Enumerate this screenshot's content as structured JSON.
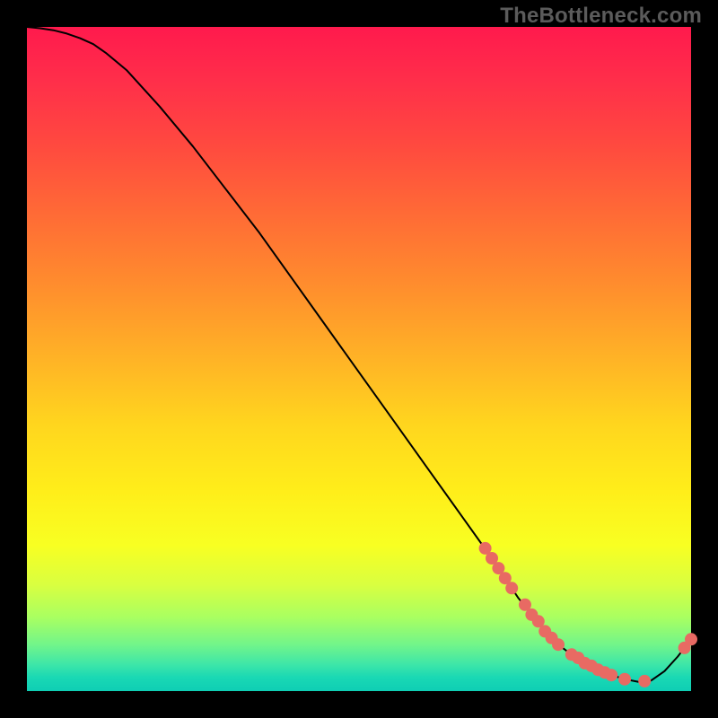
{
  "watermark": "TheBottleneck.com",
  "colors": {
    "background": "#000000",
    "curve": "#000000",
    "marker": "#e86a63"
  },
  "chart_data": {
    "type": "line",
    "title": "",
    "xlabel": "",
    "ylabel": "",
    "xlim": [
      0,
      100
    ],
    "ylim": [
      0,
      100
    ],
    "grid": false,
    "legend": "none",
    "series": [
      {
        "name": "curve",
        "x": [
          0,
          2,
          4,
          6,
          8,
          10,
          12,
          15,
          20,
          25,
          30,
          35,
          40,
          45,
          50,
          55,
          60,
          65,
          70,
          72,
          74,
          76,
          78,
          80,
          82,
          84,
          86,
          88,
          90,
          92,
          94,
          96,
          98,
          100
        ],
        "y": [
          100,
          99.8,
          99.5,
          99.0,
          98.3,
          97.4,
          96.0,
          93.5,
          88.0,
          82.0,
          75.5,
          69.0,
          62.0,
          55.0,
          48.0,
          41.0,
          34.0,
          27.0,
          20.0,
          17.0,
          14.0,
          11.5,
          9.0,
          7.0,
          5.5,
          4.2,
          3.2,
          2.4,
          1.8,
          1.4,
          1.6,
          3.0,
          5.2,
          7.8
        ]
      }
    ],
    "markers": {
      "name": "highlight-points",
      "x": [
        69,
        70,
        71,
        72,
        73,
        75,
        76,
        77,
        78,
        79,
        80,
        82,
        83,
        84,
        85,
        86,
        87,
        88,
        90,
        93,
        99,
        100
      ],
      "y": [
        21.5,
        20.0,
        18.5,
        17.0,
        15.5,
        13.0,
        11.5,
        10.5,
        9.0,
        8.0,
        7.0,
        5.5,
        5.0,
        4.2,
        3.8,
        3.2,
        2.8,
        2.4,
        1.8,
        1.5,
        6.5,
        7.8
      ]
    }
  }
}
